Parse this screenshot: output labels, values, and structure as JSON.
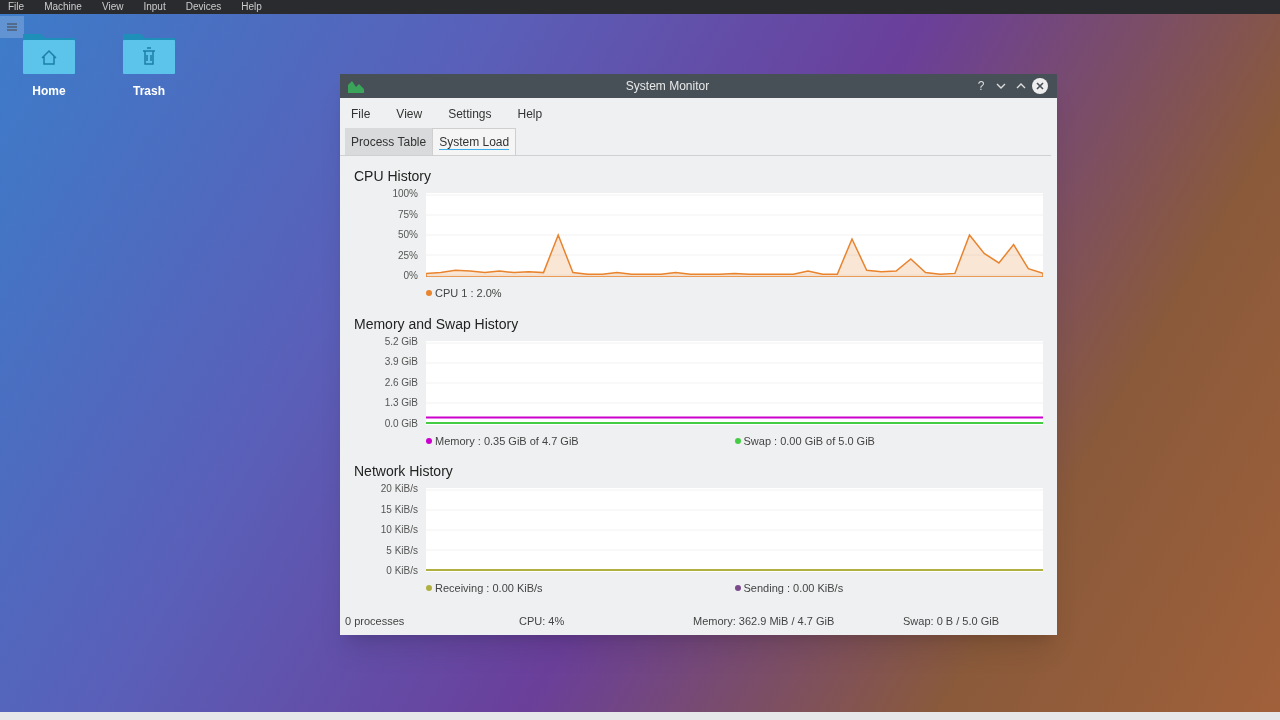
{
  "top_menu": [
    "File",
    "Machine",
    "View",
    "Input",
    "Devices",
    "Help"
  ],
  "desktop_icons": [
    {
      "label": "Home",
      "kind": "home"
    },
    {
      "label": "Trash",
      "kind": "trash"
    }
  ],
  "window": {
    "title": "System Monitor",
    "buttons": [
      "?"
    ]
  },
  "menu": [
    "File",
    "View",
    "Settings",
    "Help"
  ],
  "tabs": [
    {
      "label": "Process Table",
      "selected": false
    },
    {
      "label": "System Load",
      "selected": true
    }
  ],
  "sections": [
    {
      "title": "CPU History",
      "chart_data": {
        "type": "area",
        "grid": true,
        "yticks": [
          {
            "value": 0,
            "label": "0%"
          },
          {
            "value": 25,
            "label": "25%"
          },
          {
            "value": 50,
            "label": "50%"
          },
          {
            "value": 75,
            "label": "75%"
          },
          {
            "value": 100,
            "label": "100%"
          }
        ],
        "ylim": [
          0,
          100
        ],
        "series": [
          {
            "name": "CPU 1",
            "color": "#e8832e",
            "values": [
              2,
              3,
              6,
              5,
              3,
              5,
              3,
              4,
              3,
              50,
              3,
              1,
              1,
              3,
              1,
              1,
              1,
              3,
              1,
              1,
              1,
              2,
              1,
              1,
              1,
              1,
              5,
              1,
              1,
              45,
              6,
              4,
              5,
              20,
              3,
              1,
              2,
              50,
              27,
              15,
              38,
              8,
              2
            ]
          }
        ]
      },
      "readings": [
        ": 2.0%"
      ]
    },
    {
      "title": "Memory and Swap History",
      "chart_data": {
        "type": "line",
        "grid": true,
        "yticks": [
          {
            "value": 0,
            "label": "0.0 GiB"
          },
          {
            "value": 1.3,
            "label": "1.3 GiB"
          },
          {
            "value": 2.6,
            "label": "2.6 GiB"
          },
          {
            "value": 3.9,
            "label": "3.9 GiB"
          },
          {
            "value": 5.2,
            "label": "5.2 GiB"
          }
        ],
        "ylim": [
          0,
          5.2
        ],
        "series": [
          {
            "name": "Memory",
            "color": "#cc00cc",
            "values": [
              0.35,
              0.35,
              0.35,
              0.35,
              0.35
            ]
          },
          {
            "name": "Swap",
            "color": "#44cc44",
            "values": [
              0,
              0,
              0,
              0,
              0
            ]
          }
        ]
      },
      "readings": [
        ": 0.35 GiB of 4.7 GiB",
        ": 0.00 GiB of 5.0 GiB"
      ]
    },
    {
      "title": "Network History",
      "chart_data": {
        "type": "line",
        "grid": true,
        "yticks": [
          {
            "value": 0,
            "label": "0 KiB/s"
          },
          {
            "value": 5,
            "label": "5 KiB/s"
          },
          {
            "value": 10,
            "label": "10 KiB/s"
          },
          {
            "value": 15,
            "label": "15 KiB/s"
          },
          {
            "value": 20,
            "label": "20 KiB/s"
          }
        ],
        "ylim": [
          0,
          20
        ],
        "series": [
          {
            "name": "Receiving",
            "color": "#b0b040",
            "values": [
              0,
              0,
              0,
              0,
              0
            ]
          },
          {
            "name": "Sending",
            "color": "#7a4a8a",
            "values": [
              null,
              null,
              null,
              null,
              null
            ]
          }
        ]
      },
      "readings": [
        ": 0.00 KiB/s",
        ": 0.00 KiB/s"
      ]
    }
  ],
  "status_bar": [
    "0 processes",
    "CPU: 4%",
    "Memory: 362.9 MiB / 4.7 GiB",
    "Swap: 0 B / 5.0 GiB"
  ]
}
